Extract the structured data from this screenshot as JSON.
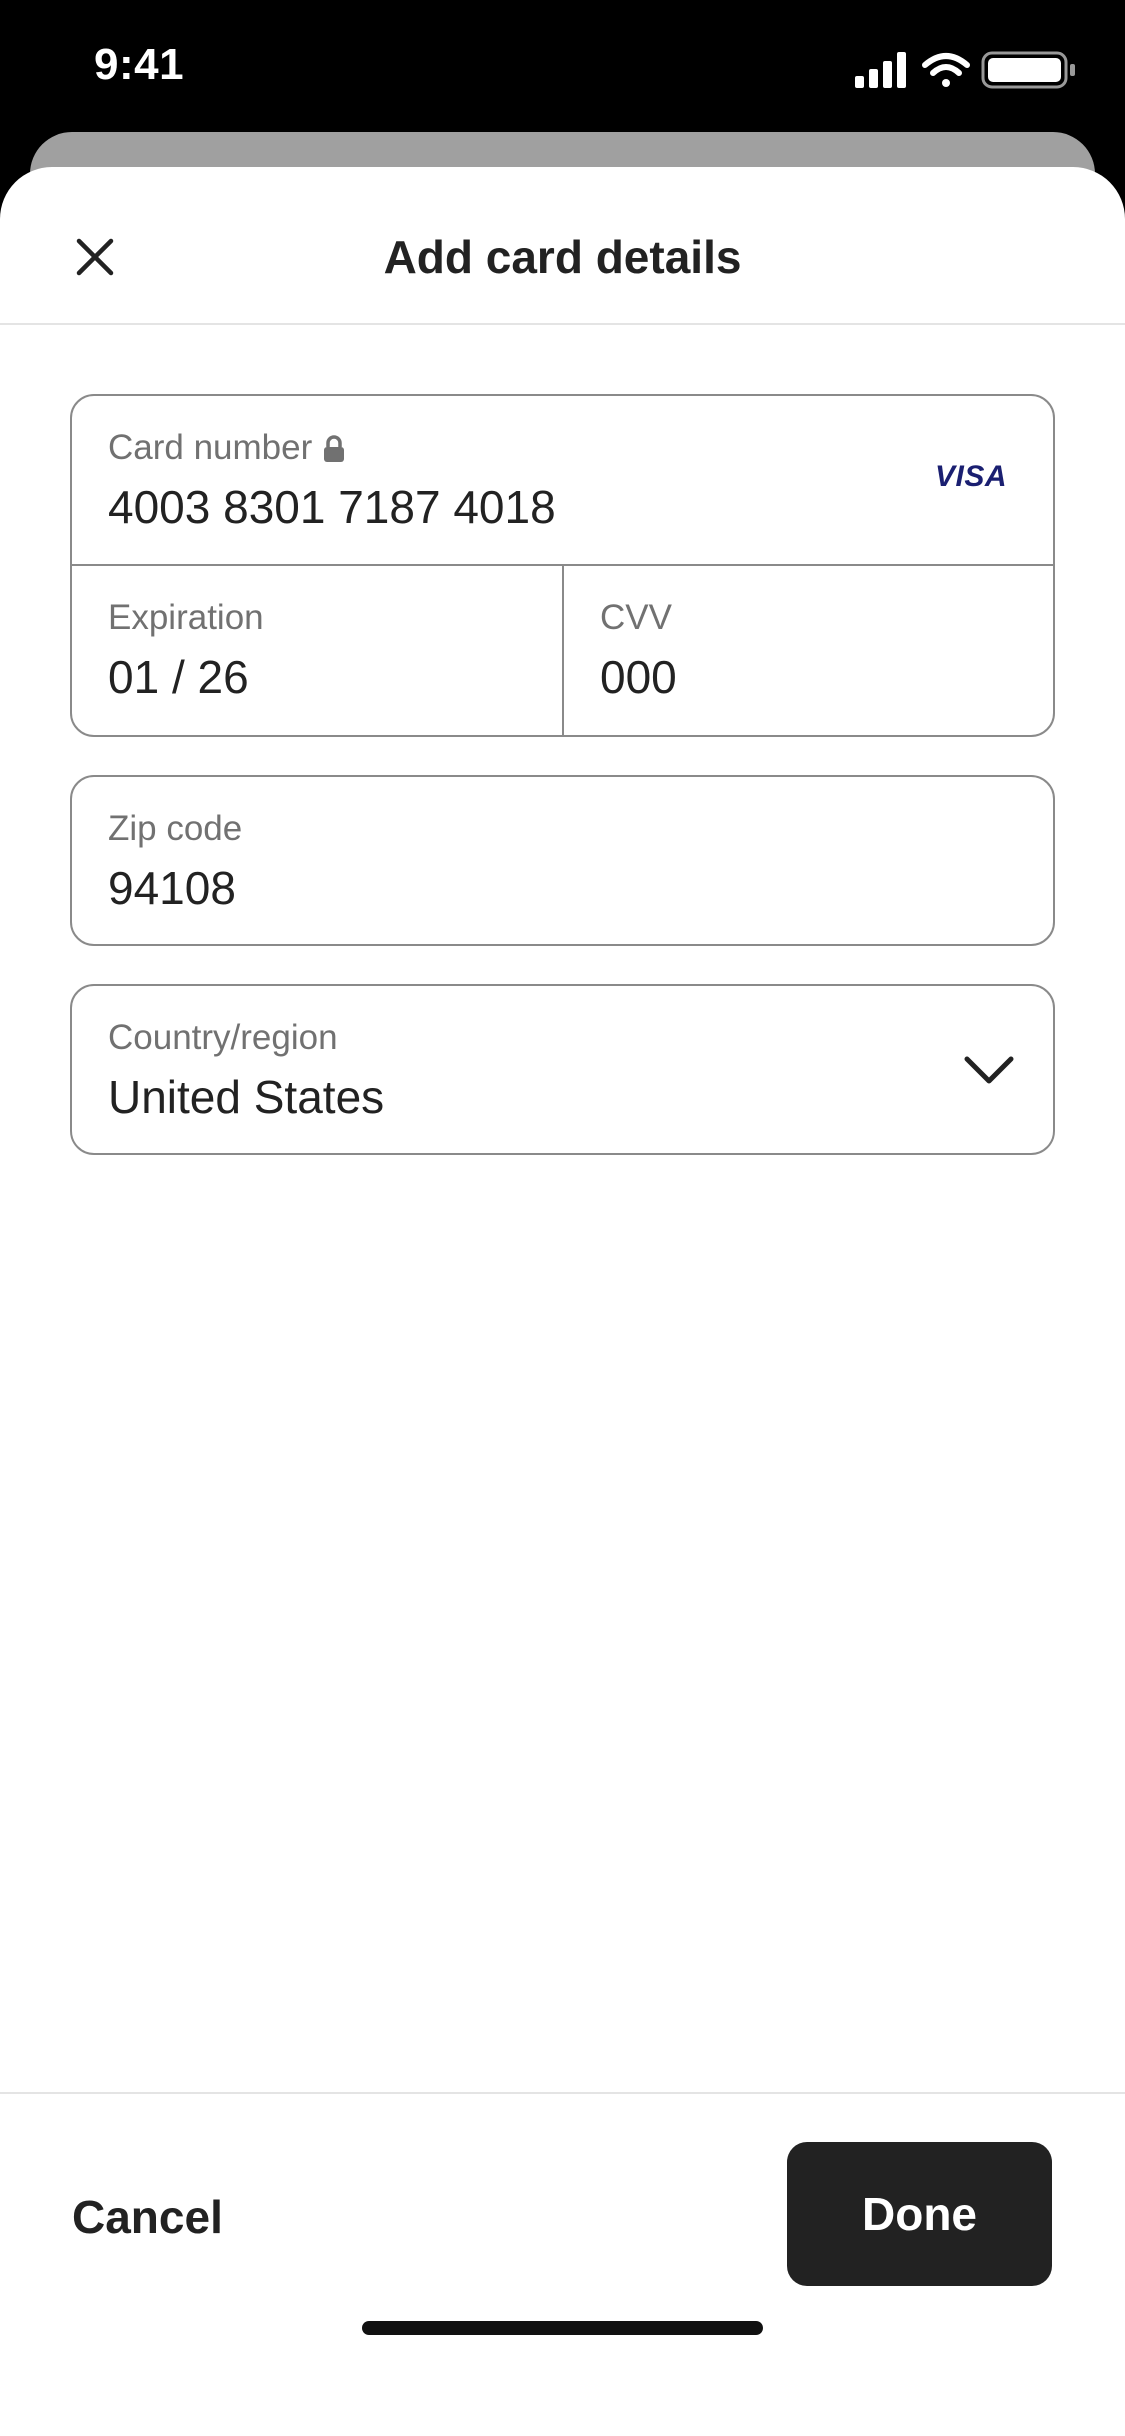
{
  "status_bar": {
    "time": "9:41"
  },
  "header": {
    "title": "Add card details"
  },
  "card": {
    "number_label": "Card number",
    "number_value": "4003 8301 7187 4018",
    "brand": "VISA",
    "expiration_label": "Expiration",
    "expiration_value": "01 / 26",
    "cvv_label": "CVV",
    "cvv_value": "000"
  },
  "zip": {
    "label": "Zip code",
    "value": "94108"
  },
  "country": {
    "label": "Country/region",
    "value": "United States"
  },
  "footer": {
    "cancel_label": "Cancel",
    "done_label": "Done"
  },
  "icons": {
    "close": "close-icon",
    "lock": "lock-icon",
    "chevron": "chevron-down-icon",
    "signal": "cellular-signal-icon",
    "wifi": "wifi-icon",
    "battery": "battery-icon"
  },
  "colors": {
    "brand_visa": "#1a1f71",
    "primary_button": "#222222",
    "label_gray": "#717171"
  }
}
